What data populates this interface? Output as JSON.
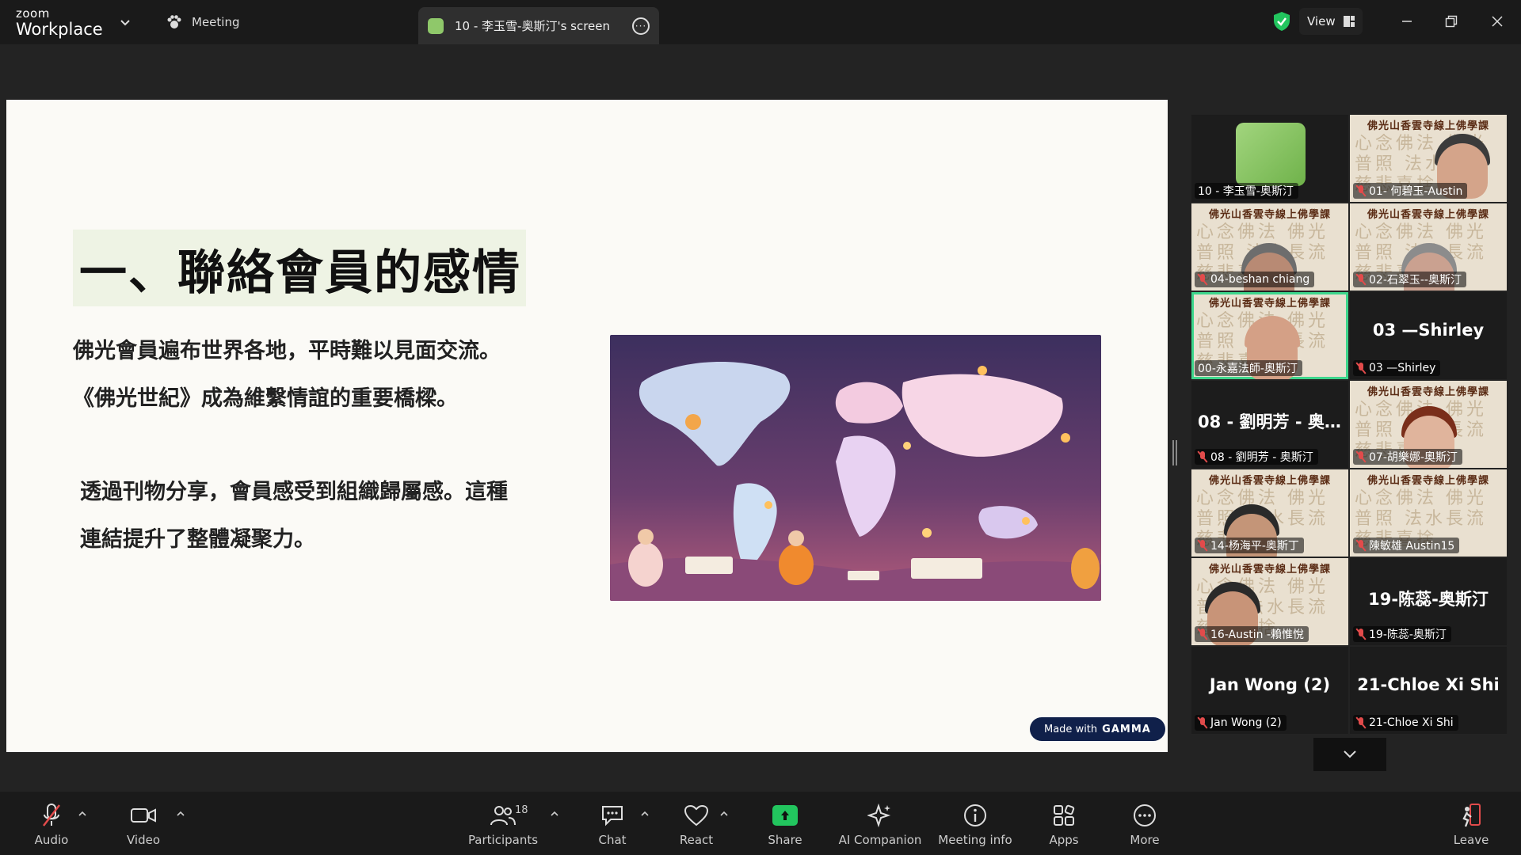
{
  "app": {
    "brand_top": "zoom",
    "brand_bottom": "Workplace",
    "meeting_tab": "Meeting",
    "share_tab": "10 - 李玉雪-奥斯汀's screen",
    "view_label": "View"
  },
  "slide": {
    "title": "一、聯絡會員的感情",
    "para1_line1": "佛光會員遍布世界各地，平時難以見面交流。",
    "para1_line2": "《佛光世紀》成為維繫情誼的重要橋樑。",
    "para2_line1": "透過刊物分享，會員感受到組織歸屬感。這種",
    "para2_line2": "連結提升了整體凝聚力。",
    "badge_prefix": "Made with",
    "badge_brand": "GAMMA"
  },
  "gallery": {
    "banner": "佛光山香雲寺線上佛學課",
    "calligraphy": "心念佛法 佛光普照 法水長流 慈悲喜捨",
    "tiles": [
      {
        "name": "10 - 李玉雪-奥斯汀",
        "muted": false,
        "kind": "green"
      },
      {
        "name": "01- 何碧玉-Austin",
        "muted": true,
        "kind": "paper"
      },
      {
        "name": "04-beshan chiang",
        "muted": true,
        "kind": "paper"
      },
      {
        "name": "02-石翠玉--奥斯汀",
        "muted": true,
        "kind": "paper"
      },
      {
        "name": "00-永嘉法師-奧斯汀",
        "muted": false,
        "kind": "paper"
      },
      {
        "name": "03 —Shirley",
        "muted": true,
        "kind": "dark",
        "center": "03 —Shirley"
      },
      {
        "name": "08 - 劉明芳 - 奥斯汀",
        "muted": true,
        "kind": "dark",
        "center": "08 - 劉明芳 - 奥..."
      },
      {
        "name": "07-胡樂娜-奧斯汀",
        "muted": true,
        "kind": "paper"
      },
      {
        "name": "14-杨海平-奥斯丁",
        "muted": true,
        "kind": "paper"
      },
      {
        "name": "陳敏雄 Austin15",
        "muted": true,
        "kind": "paper"
      },
      {
        "name": "16-Austin -賴惟悅",
        "muted": true,
        "kind": "paper"
      },
      {
        "name": "19-陈蕊-奥斯汀",
        "muted": true,
        "kind": "dark",
        "center": "19-陈蕊-奥斯汀"
      },
      {
        "name": "Jan Wong (2)",
        "muted": true,
        "kind": "dark",
        "center": "Jan Wong (2)"
      },
      {
        "name": "21-Chloe Xi Shi",
        "muted": true,
        "kind": "dark",
        "center": "21-Chloe Xi Shi"
      }
    ]
  },
  "toolbar": {
    "audio": "Audio",
    "video": "Video",
    "participants": "Participants",
    "participants_count": "18",
    "chat": "Chat",
    "react": "React",
    "share": "Share",
    "ai_companion": "AI Companion",
    "meeting_info": "Meeting info",
    "apps": "Apps",
    "more": "More",
    "leave": "Leave"
  },
  "colors": {
    "accent_green": "#22c55e",
    "active_speaker": "#3dd68c",
    "muted_red": "#e24b4b"
  }
}
